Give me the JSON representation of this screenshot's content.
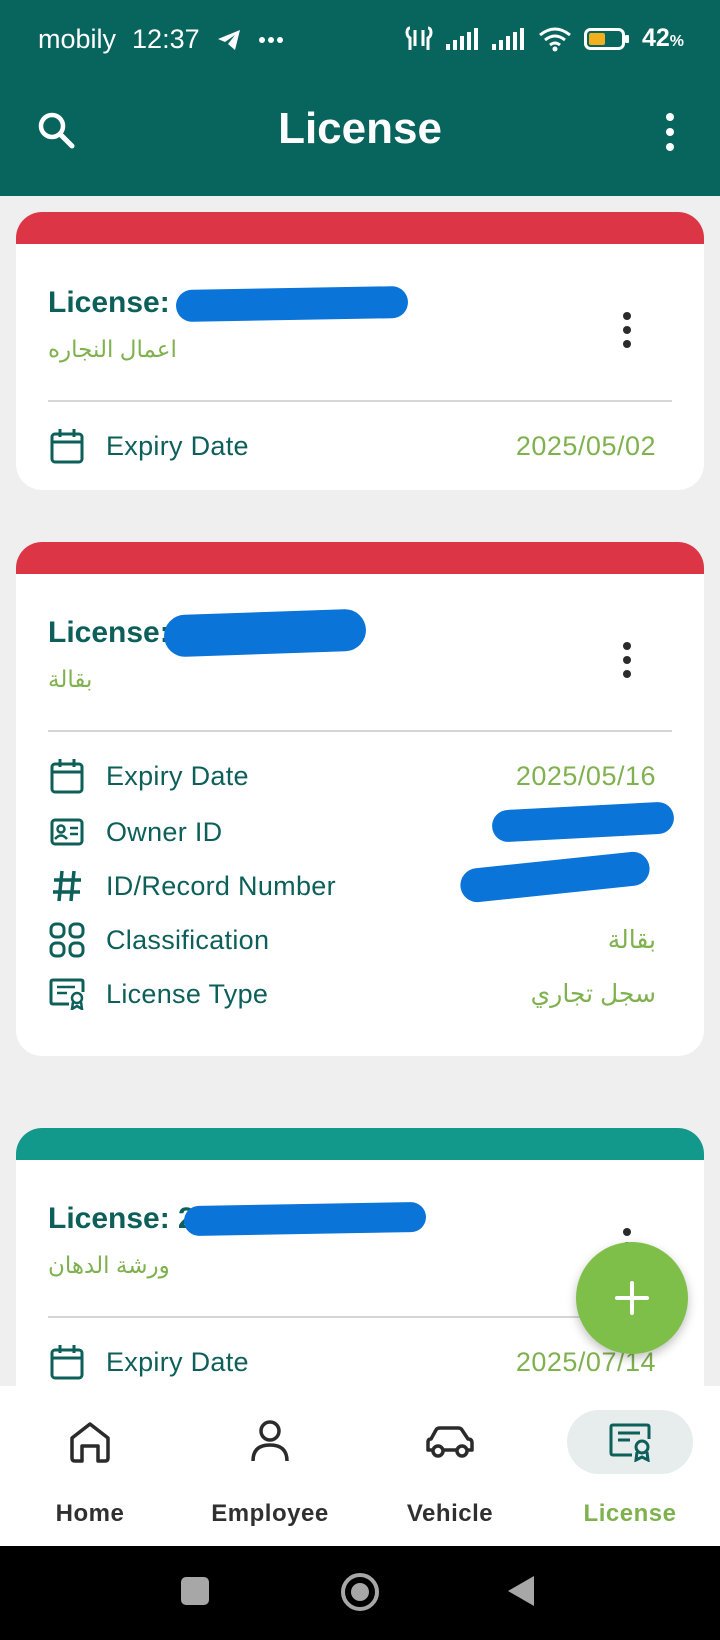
{
  "status_bar": {
    "carrier": "mobily",
    "time": "12:37",
    "battery": "42",
    "battery_unit": "%"
  },
  "app_bar": {
    "title": "License"
  },
  "cards": [
    {
      "status_color": "#dc3545",
      "title_prefix": "License: 4",
      "subtitle": "اعمال النجاره",
      "expiry_label": "Expiry Date",
      "expiry_value": "2025/05/02"
    },
    {
      "status_color": "#dc3545",
      "title_prefix": "License: 7",
      "subtitle": "بقالة",
      "expiry_label": "Expiry Date",
      "expiry_value": "2025/05/16",
      "owner_label": "Owner ID",
      "record_label": "ID/Record Number",
      "classification_label": "Classification",
      "classification_value": "بقالة",
      "type_label": "License Type",
      "type_value": "سجل تجاري"
    },
    {
      "status_color": "#13998b",
      "title_prefix": "License: 2",
      "subtitle": "ورشة الدهان",
      "expiry_label": "Expiry Date",
      "expiry_value": "2025/07/14"
    }
  ],
  "bottom_nav": {
    "items": [
      {
        "label": "Home",
        "icon": "home-icon"
      },
      {
        "label": "Employee",
        "icon": "person-icon"
      },
      {
        "label": "Vehicle",
        "icon": "car-icon"
      },
      {
        "label": "License",
        "icon": "license-icon",
        "active": true
      }
    ]
  },
  "colors": {
    "primary": "#08655e",
    "accent": "#7fb14f",
    "expired": "#dc3545",
    "active": "#13998b"
  }
}
